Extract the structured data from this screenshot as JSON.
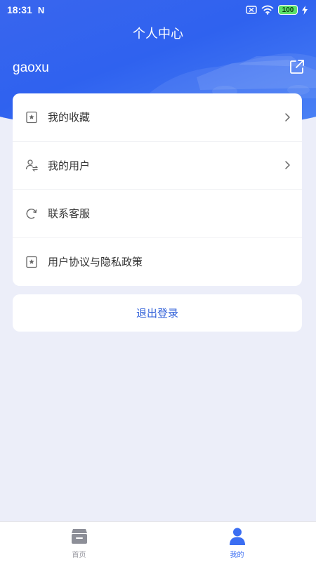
{
  "status_bar": {
    "time": "18:31",
    "network_glyph": "N",
    "battery": "100"
  },
  "header": {
    "title": "个人中心",
    "username": "gaoxu"
  },
  "menu": {
    "items": [
      {
        "label": "我的收藏",
        "icon": "bookmark-star-icon",
        "has_arrow": true
      },
      {
        "label": "我的用户",
        "icon": "user-transfer-icon",
        "has_arrow": true
      },
      {
        "label": "联系客服",
        "icon": "refresh-headset-icon",
        "has_arrow": false
      },
      {
        "label": "用户协议与隐私政策",
        "icon": "bookmark-star-icon",
        "has_arrow": false
      }
    ]
  },
  "logout": {
    "label": "退出登录"
  },
  "tabs": [
    {
      "label": "首页",
      "icon": "box-home-icon",
      "active": false
    },
    {
      "label": "我的",
      "icon": "person-icon",
      "active": true
    }
  ],
  "colors": {
    "primary": "#2f62ef",
    "accent_text": "#2f5fd8",
    "tab_active": "#3b6ef2",
    "background": "#eceef9"
  }
}
